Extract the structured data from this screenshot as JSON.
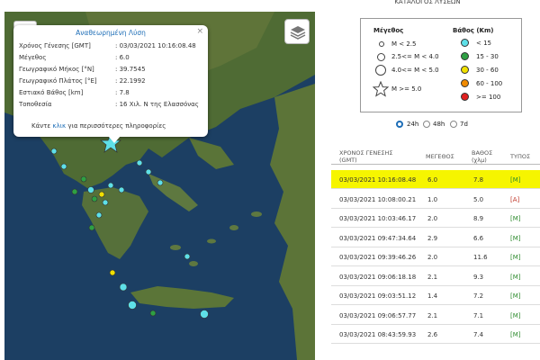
{
  "panel": {
    "title": "ΚΑΤΑΛΟΓΟΣ ΛΥΣΕΩΝ"
  },
  "popup": {
    "title": "Αναθεωρημένη Λύση",
    "close": "×",
    "rows": [
      {
        "label": "Χρόνος Γένεσης [GMT]",
        "value": ": 03/03/2021 10:16:08.48"
      },
      {
        "label": "Μέγεθος",
        "value": ": 6.0"
      },
      {
        "label": "Γεωγραφικό Μήκος [°N]",
        "value": ": 39.7545"
      },
      {
        "label": "Γεωγραφικό Πλάτος [°E]",
        "value": ": 22.1992"
      },
      {
        "label": "Εστιακό Βάθος [km]",
        "value": ": 7.8"
      },
      {
        "label": "Τοποθεσία",
        "value": ": 16 Χιλ. Ν της Ελασσόνας"
      }
    ],
    "more_pre": "Κάντε",
    "more_link": "κλικ",
    "more_post": "για περισσότερες πληροφορίες"
  },
  "map_controls": {
    "zoom_in": "+",
    "zoom_out": "−",
    "layers_icon": "layers-icon"
  },
  "legend": {
    "magnitude_title": "Μέγεθος",
    "depth_title": "Βάθος (Km)",
    "magnitude_items": [
      "M < 2.5",
      "2.5<= M < 4.0",
      "4.0<= M < 5.0",
      "M >= 5.0"
    ],
    "depth_items": [
      {
        "label": "< 15",
        "color": "#5ee0e8"
      },
      {
        "label": "15 - 30",
        "color": "#2ea043"
      },
      {
        "label": "30 - 60",
        "color": "#f0e000"
      },
      {
        "label": "60 - 100",
        "color": "#f08a00"
      },
      {
        "label": ">= 100",
        "color": "#e02020"
      }
    ]
  },
  "time_range": {
    "options": [
      "24h",
      "48h",
      "7d"
    ],
    "selected": "24h"
  },
  "table": {
    "headers": {
      "time_line1": "ΧΡΟΝΟΣ ΓΕΝΕΣΗΣ",
      "time_line2": "(GMT)",
      "magnitude": "ΜΕΓΕΘΟΣ",
      "depth_line1": "ΒΑΘΟΣ",
      "depth_line2": "(χλμ)",
      "type": "ΤΥΠΟΣ"
    },
    "rows": [
      {
        "time": "03/03/2021 10:16:08.48",
        "mag": "6.0",
        "depth": "7.8",
        "type": "[M]"
      },
      {
        "time": "03/03/2021 10:08:00.21",
        "mag": "1.0",
        "depth": "5.0",
        "type": "[A]"
      },
      {
        "time": "03/03/2021 10:03:46.17",
        "mag": "2.0",
        "depth": "8.9",
        "type": "[M]"
      },
      {
        "time": "03/03/2021 09:47:34.64",
        "mag": "2.9",
        "depth": "6.6",
        "type": "[M]"
      },
      {
        "time": "03/03/2021 09:39:46.26",
        "mag": "2.0",
        "depth": "11.6",
        "type": "[M]"
      },
      {
        "time": "03/03/2021 09:06:18.18",
        "mag": "2.1",
        "depth": "9.3",
        "type": "[M]"
      },
      {
        "time": "03/03/2021 09:03:51.12",
        "mag": "1.4",
        "depth": "7.2",
        "type": "[M]"
      },
      {
        "time": "03/03/2021 09:06:57.77",
        "mag": "2.1",
        "depth": "7.1",
        "type": "[M]"
      },
      {
        "time": "03/03/2021 08:43:59.93",
        "mag": "2.6",
        "depth": "7.4",
        "type": "[M]"
      }
    ]
  }
}
